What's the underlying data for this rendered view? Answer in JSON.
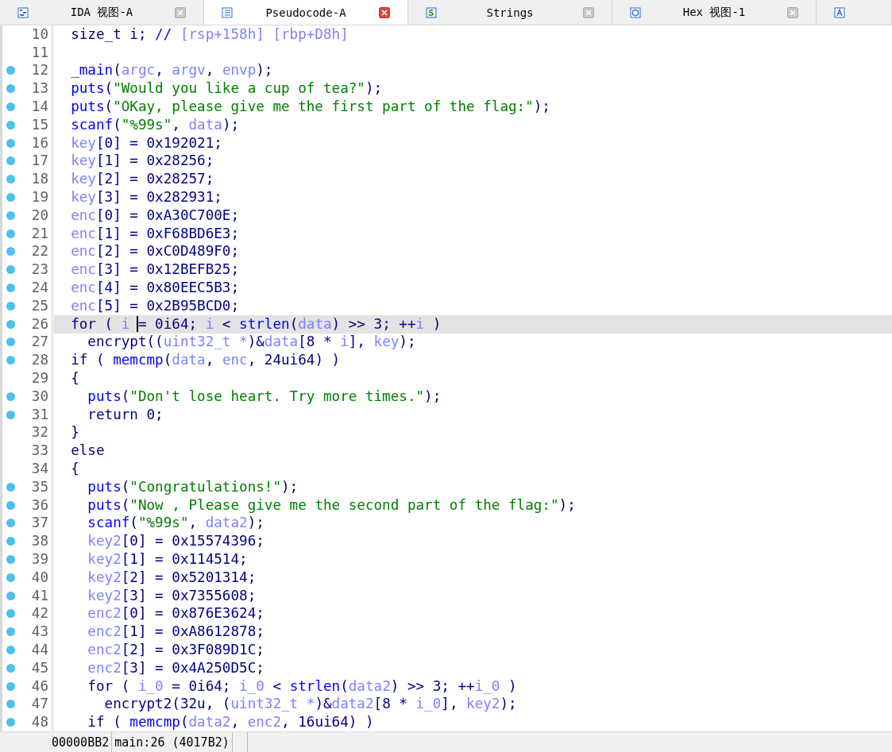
{
  "tabs": [
    {
      "label": "IDA 视图-A",
      "kind": "graph",
      "selected": false
    },
    {
      "label": "Pseudocode-A",
      "kind": "pseudocode",
      "selected": true
    },
    {
      "label": "Strings",
      "kind": "strings",
      "selected": false
    },
    {
      "label": "Hex 视图-1",
      "kind": "hex",
      "selected": false
    },
    {
      "kind": "structures",
      "selected": false
    }
  ],
  "lines": [
    {
      "number": "10",
      "breakpoint": false,
      "selected": false,
      "tokens": [
        {
          "kind": "plain",
          "text": "  size_t i; "
        },
        {
          "kind": "comment",
          "text": "// "
        },
        {
          "kind": "var",
          "text": "[rsp+158h] [rbp+D8h]"
        }
      ]
    },
    {
      "number": "11",
      "breakpoint": false,
      "selected": false
    },
    {
      "number": "12",
      "breakpoint": true,
      "selected": false,
      "tokens": [
        {
          "kind": "func",
          "text": "  _main"
        },
        {
          "kind": "plain",
          "text": "("
        },
        {
          "kind": "var",
          "text": "argc"
        },
        {
          "kind": "plain",
          "text": ", "
        },
        {
          "kind": "var",
          "text": "argv"
        },
        {
          "kind": "plain",
          "text": ", "
        },
        {
          "kind": "var",
          "text": "envp"
        },
        {
          "kind": "plain",
          "text": ");"
        }
      ]
    },
    {
      "number": "13",
      "breakpoint": true,
      "selected": false,
      "tokens": [
        {
          "kind": "func",
          "text": "  puts"
        },
        {
          "kind": "plain",
          "text": "("
        },
        {
          "kind": "str",
          "text": "\"Would you like a cup of tea?\""
        },
        {
          "kind": "plain",
          "text": ");"
        }
      ]
    },
    {
      "number": "14",
      "breakpoint": true,
      "selected": false,
      "tokens": [
        {
          "kind": "func",
          "text": "  puts"
        },
        {
          "kind": "plain",
          "text": "("
        },
        {
          "kind": "str",
          "text": "\"OKay, please give me the first part of the flag:\""
        },
        {
          "kind": "plain",
          "text": ");"
        }
      ]
    },
    {
      "number": "15",
      "breakpoint": true,
      "selected": false,
      "tokens": [
        {
          "kind": "func",
          "text": "  scanf"
        },
        {
          "kind": "plain",
          "text": "("
        },
        {
          "kind": "str",
          "text": "\"%99s\""
        },
        {
          "kind": "plain",
          "text": ", "
        },
        {
          "kind": "var",
          "text": "data"
        },
        {
          "kind": "plain",
          "text": ");"
        }
      ]
    },
    {
      "number": "16",
      "breakpoint": true,
      "selected": false,
      "tokens": [
        {
          "kind": "var",
          "text": "  key"
        },
        {
          "kind": "plain",
          "text": "[0] = 0x192021;"
        }
      ]
    },
    {
      "number": "17",
      "breakpoint": true,
      "selected": false,
      "tokens": [
        {
          "kind": "var",
          "text": "  key"
        },
        {
          "kind": "plain",
          "text": "[1] = 0x28256;"
        }
      ]
    },
    {
      "number": "18",
      "breakpoint": true,
      "selected": false,
      "tokens": [
        {
          "kind": "var",
          "text": "  key"
        },
        {
          "kind": "plain",
          "text": "[2] = 0x28257;"
        }
      ]
    },
    {
      "number": "19",
      "breakpoint": true,
      "selected": false,
      "tokens": [
        {
          "kind": "var",
          "text": "  key"
        },
        {
          "kind": "plain",
          "text": "[3] = 0x282931;"
        }
      ]
    },
    {
      "number": "20",
      "breakpoint": true,
      "selected": false,
      "tokens": [
        {
          "kind": "var",
          "text": "  enc"
        },
        {
          "kind": "plain",
          "text": "[0] = 0xA30C700E;"
        }
      ]
    },
    {
      "number": "21",
      "breakpoint": true,
      "selected": false,
      "tokens": [
        {
          "kind": "var",
          "text": "  enc"
        },
        {
          "kind": "plain",
          "text": "[1] = 0xF68BD6E3;"
        }
      ]
    },
    {
      "number": "22",
      "breakpoint": true,
      "selected": false,
      "tokens": [
        {
          "kind": "var",
          "text": "  enc"
        },
        {
          "kind": "plain",
          "text": "[2] = 0xC0D489F0;"
        }
      ]
    },
    {
      "number": "23",
      "breakpoint": true,
      "selected": false,
      "tokens": [
        {
          "kind": "var",
          "text": "  enc"
        },
        {
          "kind": "plain",
          "text": "[3] = 0x12BEFB25;"
        }
      ]
    },
    {
      "number": "24",
      "breakpoint": true,
      "selected": false,
      "tokens": [
        {
          "kind": "var",
          "text": "  enc"
        },
        {
          "kind": "plain",
          "text": "[4] = 0x80EEC5B3;"
        }
      ]
    },
    {
      "number": "25",
      "breakpoint": true,
      "selected": false,
      "tokens": [
        {
          "kind": "var",
          "text": "  enc"
        },
        {
          "kind": "plain",
          "text": "[5] = 0x2B95BCD0;"
        }
      ]
    },
    {
      "number": "26",
      "breakpoint": true,
      "selected": true,
      "tokens": [
        {
          "kind": "plain",
          "text": "  for ( "
        },
        {
          "kind": "var",
          "text": "i "
        },
        {
          "kind": "plain",
          "text": "= 0i64; ",
          "caret": true
        },
        {
          "kind": "var",
          "text": "i"
        },
        {
          "kind": "plain",
          "text": " < "
        },
        {
          "kind": "func",
          "text": "strlen"
        },
        {
          "kind": "plain",
          "text": "("
        },
        {
          "kind": "var",
          "text": "data"
        },
        {
          "kind": "plain",
          "text": ") >> 3; ++"
        },
        {
          "kind": "var",
          "text": "i"
        },
        {
          "kind": "plain",
          "text": " )"
        }
      ]
    },
    {
      "number": "27",
      "breakpoint": true,
      "selected": false,
      "tokens": [
        {
          "kind": "plain",
          "text": "    encrypt(("
        },
        {
          "kind": "var",
          "text": "uint32_t *"
        },
        {
          "kind": "plain",
          "text": ")&"
        },
        {
          "kind": "var",
          "text": "data"
        },
        {
          "kind": "plain",
          "text": "[8 * "
        },
        {
          "kind": "var",
          "text": "i"
        },
        {
          "kind": "plain",
          "text": "], "
        },
        {
          "kind": "var",
          "text": "key"
        },
        {
          "kind": "plain",
          "text": ");"
        }
      ]
    },
    {
      "number": "28",
      "breakpoint": true,
      "selected": false,
      "tokens": [
        {
          "kind": "plain",
          "text": "  if ( "
        },
        {
          "kind": "func",
          "text": "memcmp"
        },
        {
          "kind": "plain",
          "text": "("
        },
        {
          "kind": "var",
          "text": "data"
        },
        {
          "kind": "plain",
          "text": ", "
        },
        {
          "kind": "var",
          "text": "enc"
        },
        {
          "kind": "plain",
          "text": ", 24ui64) )"
        }
      ]
    },
    {
      "number": "29",
      "breakpoint": false,
      "selected": false,
      "tokens": [
        {
          "kind": "plain",
          "text": "  {"
        }
      ]
    },
    {
      "number": "30",
      "breakpoint": true,
      "selected": false,
      "tokens": [
        {
          "kind": "func",
          "text": "    puts"
        },
        {
          "kind": "plain",
          "text": "("
        },
        {
          "kind": "str",
          "text": "\"Don't lose heart. Try more times.\""
        },
        {
          "kind": "plain",
          "text": ");"
        }
      ]
    },
    {
      "number": "31",
      "breakpoint": true,
      "selected": false,
      "tokens": [
        {
          "kind": "plain",
          "text": "    return 0;"
        }
      ]
    },
    {
      "number": "32",
      "breakpoint": false,
      "selected": false,
      "tokens": [
        {
          "kind": "plain",
          "text": "  }"
        }
      ]
    },
    {
      "number": "33",
      "breakpoint": false,
      "selected": false,
      "tokens": [
        {
          "kind": "plain",
          "text": "  else"
        }
      ]
    },
    {
      "number": "34",
      "breakpoint": false,
      "selected": false,
      "tokens": [
        {
          "kind": "plain",
          "text": "  {"
        }
      ]
    },
    {
      "number": "35",
      "breakpoint": true,
      "selected": false,
      "tokens": [
        {
          "kind": "func",
          "text": "    puts"
        },
        {
          "kind": "plain",
          "text": "("
        },
        {
          "kind": "str",
          "text": "\"Congratulations!\""
        },
        {
          "kind": "plain",
          "text": ");"
        }
      ]
    },
    {
      "number": "36",
      "breakpoint": true,
      "selected": false,
      "tokens": [
        {
          "kind": "func",
          "text": "    puts"
        },
        {
          "kind": "plain",
          "text": "("
        },
        {
          "kind": "str",
          "text": "\"Now , Please give me the second part of the flag:\""
        },
        {
          "kind": "plain",
          "text": ");"
        }
      ]
    },
    {
      "number": "37",
      "breakpoint": true,
      "selected": false,
      "tokens": [
        {
          "kind": "func",
          "text": "    scanf"
        },
        {
          "kind": "plain",
          "text": "("
        },
        {
          "kind": "str",
          "text": "\"%99s\""
        },
        {
          "kind": "plain",
          "text": ", "
        },
        {
          "kind": "var",
          "text": "data2"
        },
        {
          "kind": "plain",
          "text": ");"
        }
      ]
    },
    {
      "number": "38",
      "breakpoint": true,
      "selected": false,
      "tokens": [
        {
          "kind": "var",
          "text": "    key2"
        },
        {
          "kind": "plain",
          "text": "[0] = 0x15574396;"
        }
      ]
    },
    {
      "number": "39",
      "breakpoint": true,
      "selected": false,
      "tokens": [
        {
          "kind": "var",
          "text": "    key2"
        },
        {
          "kind": "plain",
          "text": "[1] = 0x114514;"
        }
      ]
    },
    {
      "number": "40",
      "breakpoint": true,
      "selected": false,
      "tokens": [
        {
          "kind": "var",
          "text": "    key2"
        },
        {
          "kind": "plain",
          "text": "[2] = 0x5201314;"
        }
      ]
    },
    {
      "number": "41",
      "breakpoint": true,
      "selected": false,
      "tokens": [
        {
          "kind": "var",
          "text": "    key2"
        },
        {
          "kind": "plain",
          "text": "[3] = 0x7355608;"
        }
      ]
    },
    {
      "number": "42",
      "breakpoint": true,
      "selected": false,
      "tokens": [
        {
          "kind": "var",
          "text": "    enc2"
        },
        {
          "kind": "plain",
          "text": "[0] = 0x876E3624;"
        }
      ]
    },
    {
      "number": "43",
      "breakpoint": true,
      "selected": false,
      "tokens": [
        {
          "kind": "var",
          "text": "    enc2"
        },
        {
          "kind": "plain",
          "text": "[1] = 0xA8612878;"
        }
      ]
    },
    {
      "number": "44",
      "breakpoint": true,
      "selected": false,
      "tokens": [
        {
          "kind": "var",
          "text": "    enc2"
        },
        {
          "kind": "plain",
          "text": "[2] = 0x3F089D1C;"
        }
      ]
    },
    {
      "number": "45",
      "breakpoint": true,
      "selected": false,
      "tokens": [
        {
          "kind": "var",
          "text": "    enc2"
        },
        {
          "kind": "plain",
          "text": "[3] = 0x4A250D5C;"
        }
      ]
    },
    {
      "number": "46",
      "breakpoint": true,
      "selected": false,
      "tokens": [
        {
          "kind": "plain",
          "text": "    for ( "
        },
        {
          "kind": "var",
          "text": "i_0"
        },
        {
          "kind": "plain",
          "text": " = 0i64; "
        },
        {
          "kind": "var",
          "text": "i_0"
        },
        {
          "kind": "plain",
          "text": " < "
        },
        {
          "kind": "func",
          "text": "strlen"
        },
        {
          "kind": "plain",
          "text": "("
        },
        {
          "kind": "var",
          "text": "data2"
        },
        {
          "kind": "plain",
          "text": ") >> 3; ++"
        },
        {
          "kind": "var",
          "text": "i_0"
        },
        {
          "kind": "plain",
          "text": " )"
        }
      ]
    },
    {
      "number": "47",
      "breakpoint": true,
      "selected": false,
      "tokens": [
        {
          "kind": "plain",
          "text": "      encrypt2(32u, ("
        },
        {
          "kind": "var",
          "text": "uint32_t *"
        },
        {
          "kind": "plain",
          "text": ")&"
        },
        {
          "kind": "var",
          "text": "data2"
        },
        {
          "kind": "plain",
          "text": "[8 * "
        },
        {
          "kind": "var",
          "text": "i_0"
        },
        {
          "kind": "plain",
          "text": "], "
        },
        {
          "kind": "var",
          "text": "key2"
        },
        {
          "kind": "plain",
          "text": ");"
        }
      ]
    },
    {
      "number": "48",
      "breakpoint": true,
      "selected": false,
      "tokens": [
        {
          "kind": "plain",
          "text": "    if ( "
        },
        {
          "kind": "func",
          "text": "memcmp"
        },
        {
          "kind": "plain",
          "text": "("
        },
        {
          "kind": "var",
          "text": "data2"
        },
        {
          "kind": "plain",
          "text": ", "
        },
        {
          "kind": "var",
          "text": "enc2"
        },
        {
          "kind": "plain",
          "text": ", 16ui64) )"
        }
      ]
    }
  ],
  "status_bar": {
    "offset": "00000BB2",
    "location": "main:26 (4017B2)"
  }
}
